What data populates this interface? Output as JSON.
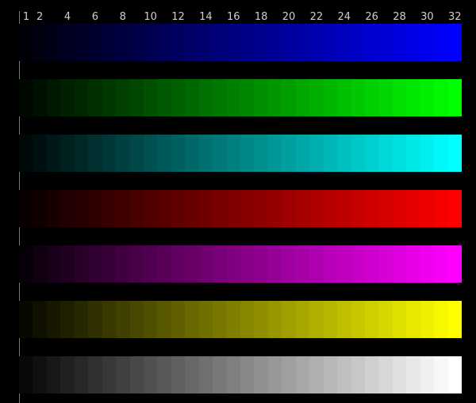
{
  "scale": {
    "labels": [
      "1",
      "2",
      "4",
      "6",
      "8",
      "10",
      "12",
      "14",
      "16",
      "18",
      "20",
      "22",
      "24",
      "26",
      "28",
      "30",
      "32"
    ],
    "positions": [
      1,
      2,
      4,
      6,
      8,
      10,
      12,
      14,
      16,
      18,
      20,
      22,
      24,
      26,
      28,
      30,
      32
    ]
  },
  "step_count": 32,
  "bars": [
    {
      "name": "blue",
      "color": "#0000ff"
    },
    {
      "name": "green",
      "color": "#00ff00"
    },
    {
      "name": "cyan",
      "color": "#00ffff"
    },
    {
      "name": "red",
      "color": "#ff0000"
    },
    {
      "name": "magenta",
      "color": "#ff00ff"
    },
    {
      "name": "yellow",
      "color": "#ffff00"
    },
    {
      "name": "gray",
      "color": "#ffffff"
    }
  ]
}
